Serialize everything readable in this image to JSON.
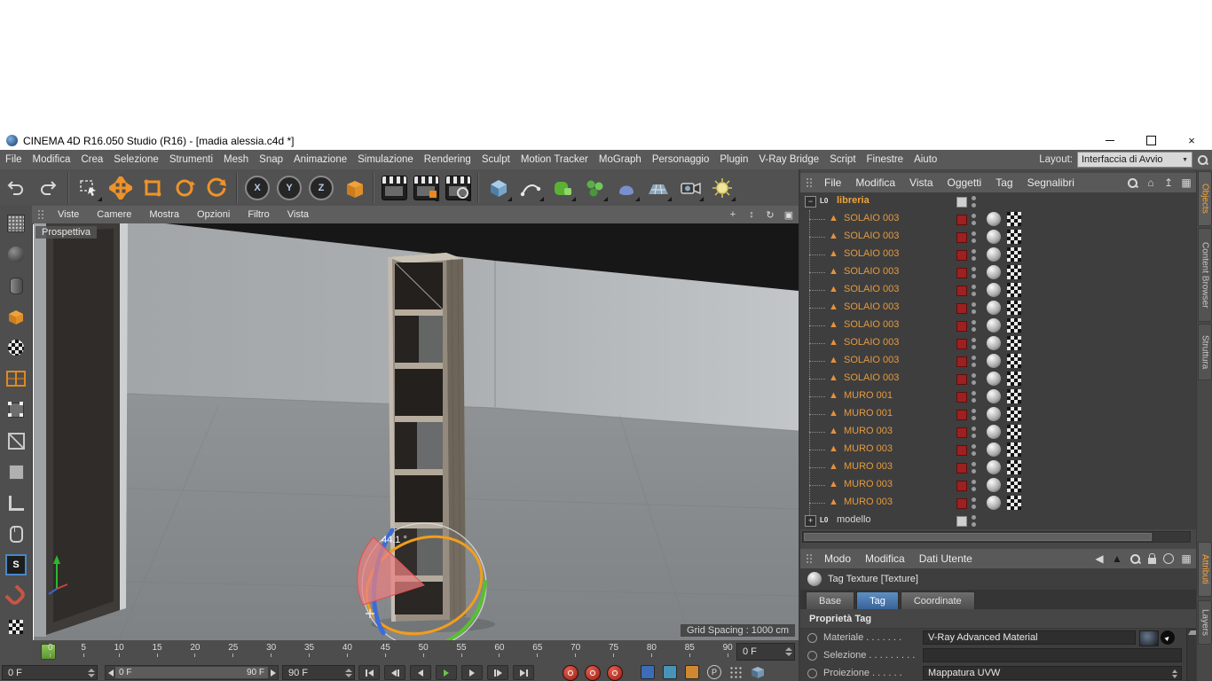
{
  "window": {
    "title": "CINEMA 4D R16.050 Studio (R16) - [madia alessia.c4d *]"
  },
  "menubar": {
    "items": [
      "File",
      "Modifica",
      "Crea",
      "Selezione",
      "Strumenti",
      "Mesh",
      "Snap",
      "Animazione",
      "Simulazione",
      "Rendering",
      "Sculpt",
      "Motion Tracker",
      "MoGraph",
      "Personaggio",
      "Plugin",
      "V-Ray Bridge",
      "Script",
      "Finestre",
      "Aiuto"
    ],
    "layout_label": "Layout:",
    "layout_value": "Interfaccia di Avvio"
  },
  "viewport": {
    "menu": [
      "Viste",
      "Camere",
      "Mostra",
      "Opzioni",
      "Filtro",
      "Vista"
    ],
    "camera_label": "Prospettiva",
    "grid_spacing_label": "Grid Spacing : 1000 cm",
    "rotation_angle": "44.1 °"
  },
  "timeline": {
    "ticks": [
      "0",
      "5",
      "10",
      "15",
      "20",
      "25",
      "30",
      "35",
      "40",
      "45",
      "50",
      "55",
      "60",
      "65",
      "70",
      "75",
      "80",
      "85",
      "90"
    ],
    "frame_field": "0 F"
  },
  "transport": {
    "current_frame": "0 F",
    "range_start": "0 F",
    "range_end": "90 F",
    "end_frame": "90 F"
  },
  "object_manager": {
    "menu": [
      "File",
      "Modifica",
      "Vista",
      "Oggetti",
      "Tag",
      "Segnalibri"
    ],
    "rows": [
      {
        "name": "libreria",
        "kind": "group",
        "expander": "−"
      },
      {
        "name": "SOLAIO 003",
        "kind": "object"
      },
      {
        "name": "SOLAIO 003",
        "kind": "object"
      },
      {
        "name": "SOLAIO 003",
        "kind": "object"
      },
      {
        "name": "SOLAIO 003",
        "kind": "object"
      },
      {
        "name": "SOLAIO 003",
        "kind": "object"
      },
      {
        "name": "SOLAIO 003",
        "kind": "object"
      },
      {
        "name": "SOLAIO 003",
        "kind": "object"
      },
      {
        "name": "SOLAIO 003",
        "kind": "object"
      },
      {
        "name": "SOLAIO 003",
        "kind": "object"
      },
      {
        "name": "SOLAIO 003",
        "kind": "object"
      },
      {
        "name": "MURO 001",
        "k ind": "object"
      },
      {
        "name": "MURO 001",
        "kind": "object"
      },
      {
        "name": "MURO 003",
        "kind": "object"
      },
      {
        "name": "MURO 003",
        "kind": "object"
      },
      {
        "name": "MURO 003",
        "kind": "object"
      },
      {
        "name": "MURO 003",
        "kind": "object"
      },
      {
        "name": "MURO 003",
        "kind": "object"
      },
      {
        "name": "modello",
        "kind": "group",
        "expander": "+"
      }
    ]
  },
  "attribute_manager": {
    "menu": [
      "Modo",
      "Modifica",
      "Dati Utente"
    ],
    "title": "Tag Texture [Texture]",
    "tabs": [
      "Base",
      "Tag",
      "Coordinate"
    ],
    "active_tab": "Tag",
    "section": "Proprietà Tag",
    "fields": {
      "materiale_label": "Materiale . . . . . . .",
      "materiale_value": "V-Ray Advanced Material",
      "selezione_label": "Selezione . . . . . . . . .",
      "selezione_value": "",
      "proiezione_label": "Proiezione . . . . . .",
      "proiezione_value": "Mappatura UVW"
    }
  },
  "side_tabs": {
    "objects": "Objects",
    "content_browser": "Content Browser",
    "struttura": "Struttura",
    "attributi": "Attributi",
    "layers": "Layers"
  },
  "icons": {
    "close": "×",
    "dropdown": "▼",
    "home": "⌂",
    "scroll_up": "↥",
    "pan": "+",
    "dolly": "↕",
    "orbit": "↻",
    "maximize_view": "▣",
    "grid": "▦",
    "back": "◀",
    "menu_up": "▲",
    "picker": "▲",
    "snap": "S",
    "param": "P",
    "null": "L0",
    "object": "▲"
  },
  "colors": {
    "accent_orange": "#f09a28",
    "object_name_orange": "#e59a3e",
    "layer_red": "#9e2020",
    "active_tab_blue": "#3a6397",
    "marker_green": "#7ab648"
  }
}
